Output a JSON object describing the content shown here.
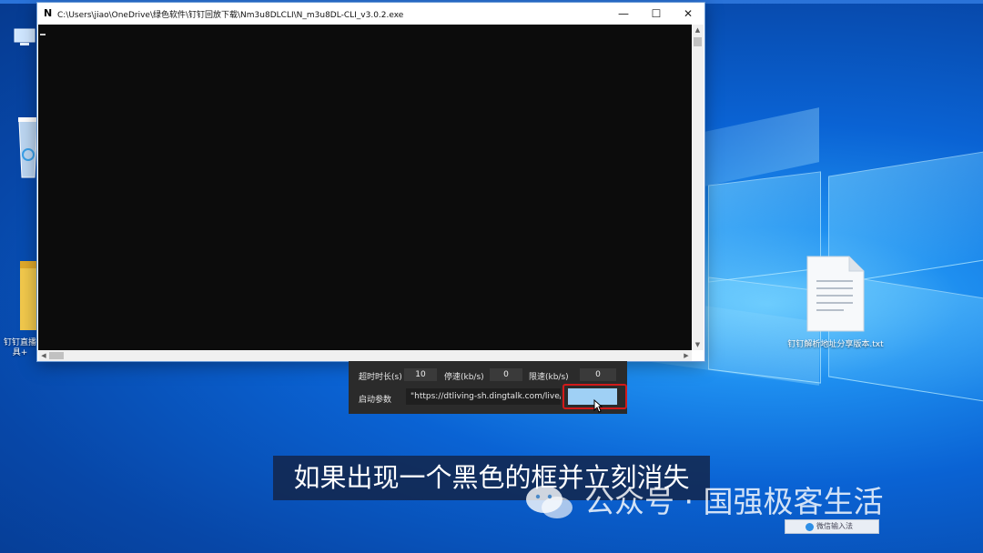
{
  "window": {
    "app_icon_letter": "N",
    "title": "C:\\Users\\jiao\\OneDrive\\绿色软件\\钉钉回放下载\\Nm3u8DLCLI\\N_m3u8DL-CLI_v3.0.2.exe",
    "minimize_glyph": "—",
    "maximize_glyph": "☐",
    "close_glyph": "✕"
  },
  "settings": {
    "timeout_label": "超时时长(s)",
    "timeout_value": "10",
    "stop_speed_label": "停速(kb/s)",
    "stop_speed_value": "0",
    "limit_speed_label": "限速(kb/s)",
    "limit_speed_value": "0",
    "startup_args_label": "启动参数",
    "startup_args_value": "\"https://dtliving-sh.dingtalk.com/live/c"
  },
  "desktop": {
    "folder_label_line1": "钉钉直播",
    "folder_label_line2": "具+",
    "text_file_label": "钉钉解析地址分享版本.txt"
  },
  "caption": {
    "subtitle": "如果出现一个黑色的框并立刻消失",
    "watermark": "公众号 · 国强极客生活"
  },
  "taskbar": {
    "ime_label": "微信输入法"
  },
  "colors": {
    "console_bg": "#0c0c0c",
    "panel_bg": "#2b2b2b",
    "highlight_border": "#d11a1a",
    "start_button": "#9fd0f5"
  },
  "icons": [
    "app-icon",
    "minimize-icon",
    "maximize-icon",
    "close-icon",
    "recycle-bin-icon",
    "folder-icon",
    "text-file-icon",
    "mouse-cursor-icon",
    "wechat-logo-icon"
  ]
}
